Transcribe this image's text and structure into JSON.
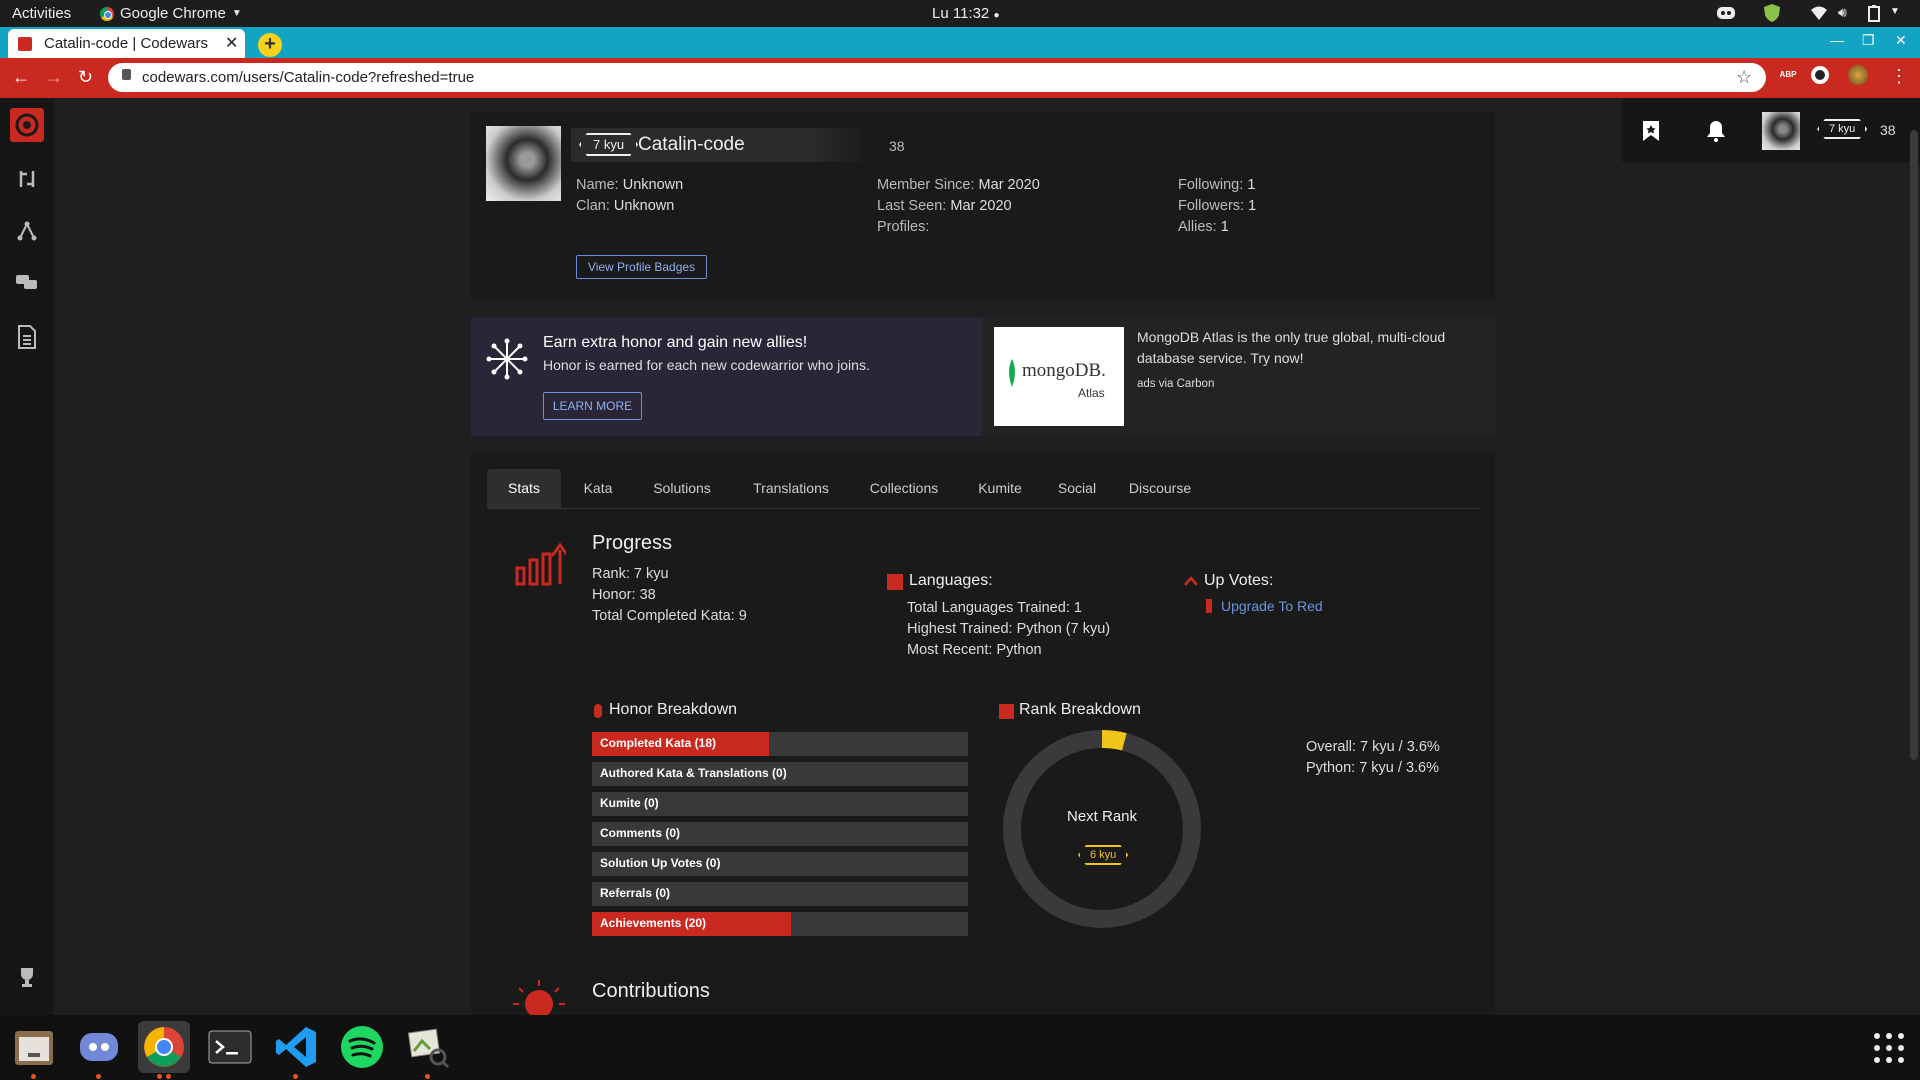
{
  "system": {
    "activities": "Activities",
    "app_name": "Google Chrome",
    "clock": "Lu 11:32"
  },
  "browser": {
    "tab_title": "Catalin-code | Codewars",
    "url": "codewars.com/users/Catalin-code?refreshed=true",
    "new_tab": "+",
    "ext_abp": "ABP"
  },
  "header": {
    "rank": "7 kyu",
    "honor": "38"
  },
  "profile": {
    "rank": "7 kyu",
    "username": "Catalin-code",
    "honor": "38",
    "col1": [
      {
        "k": "Name:",
        "v": "Unknown"
      },
      {
        "k": "Clan:",
        "v": "Unknown"
      }
    ],
    "col2": [
      {
        "k": "Member Since:",
        "v": "Mar 2020"
      },
      {
        "k": "Last Seen:",
        "v": "Mar 2020"
      },
      {
        "k": "Profiles:",
        "v": ""
      }
    ],
    "col3": [
      {
        "k": "Following:",
        "v": "1"
      },
      {
        "k": "Followers:",
        "v": "1"
      },
      {
        "k": "Allies:",
        "v": "1"
      }
    ],
    "badges_button": "View Profile Badges"
  },
  "promo": {
    "title": "Earn extra honor and gain new allies!",
    "subtitle": "Honor is earned for each new codewarrior who joins.",
    "button": "LEARN MORE"
  },
  "ad": {
    "logo_text": "mongoDB.",
    "logo_sub": "Atlas",
    "text": "MongoDB Atlas is the only true global, multi-cloud database service. Try now!",
    "via": "ads via Carbon"
  },
  "tabs": [
    "Stats",
    "Kata",
    "Solutions",
    "Translations",
    "Collections",
    "Kumite",
    "Social",
    "Discourse"
  ],
  "progress": {
    "title": "Progress",
    "rank": {
      "k": "Rank:",
      "v": "7 kyu"
    },
    "honor": {
      "k": "Honor:",
      "v": "38"
    },
    "completed": {
      "k": "Total Completed Kata:",
      "v": "9"
    }
  },
  "languages": {
    "title": "Languages:",
    "trained": {
      "k": "Total Languages Trained:",
      "v": "1"
    },
    "highest": {
      "k": "Highest Trained:",
      "v": "Python (7 kyu)"
    },
    "recent": {
      "k": "Most Recent:",
      "v": "Python"
    }
  },
  "upvotes": {
    "title": "Up Votes:",
    "link": "Upgrade To Red"
  },
  "honor_breakdown": {
    "title": "Honor Breakdown",
    "bars": [
      {
        "label": "Completed Kata (18)",
        "fill": 0.47
      },
      {
        "label": "Authored Kata & Translations (0)",
        "fill": 0
      },
      {
        "label": "Kumite (0)",
        "fill": 0
      },
      {
        "label": "Comments (0)",
        "fill": 0
      },
      {
        "label": "Solution Up Votes (0)",
        "fill": 0
      },
      {
        "label": "Referrals (0)",
        "fill": 0
      },
      {
        "label": "Achievements (20)",
        "fill": 0.53
      }
    ]
  },
  "rank_breakdown": {
    "title": "Rank Breakdown",
    "next_rank_label": "Next Rank",
    "next_rank": "6 kyu",
    "progress": 0.036,
    "overall": {
      "k": "Overall:",
      "v": "7 kyu / 3.6%"
    },
    "python": {
      "k": "Python:",
      "v": "7 kyu / 3.6%"
    }
  },
  "contributions": {
    "title": "Contributions"
  },
  "colors": {
    "accent": "#c9291e",
    "tab_bar": "#14a4c3",
    "rank_yellow": "#f0c419",
    "link": "#6a95e0"
  }
}
